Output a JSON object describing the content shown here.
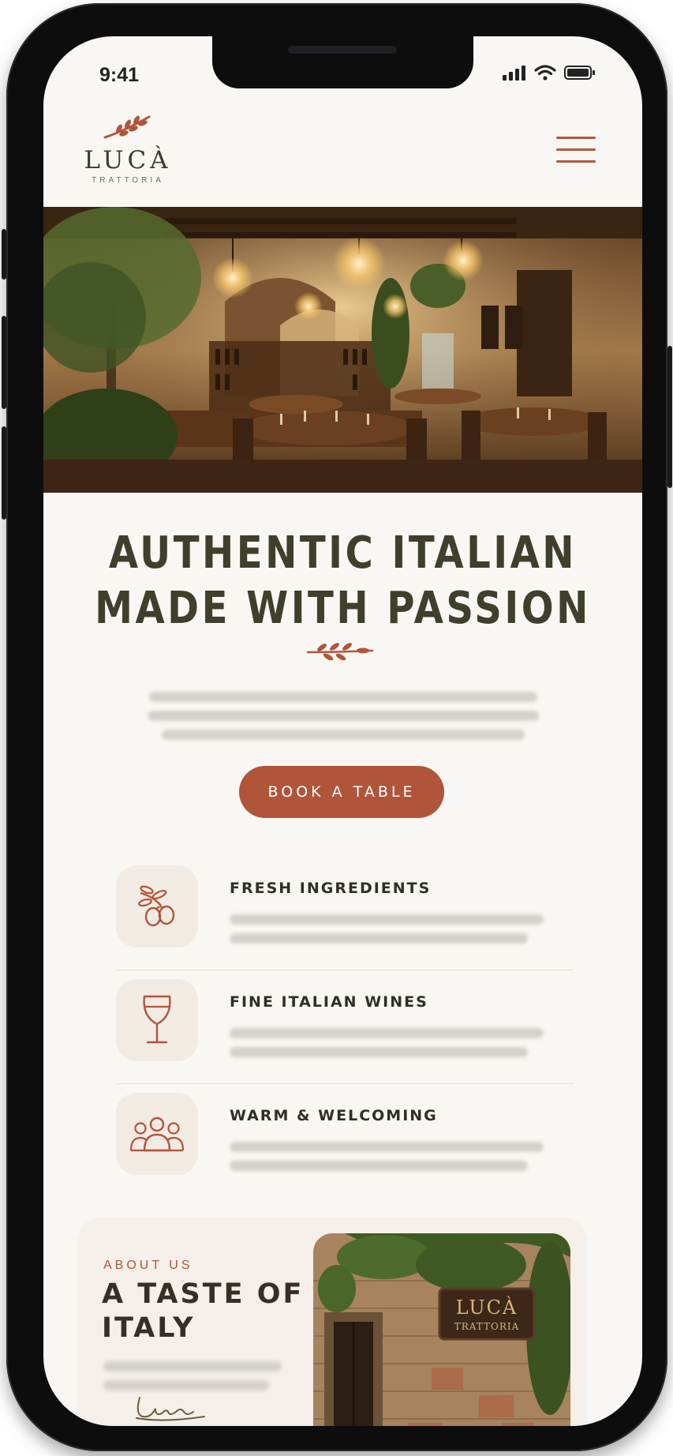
{
  "status_bar": {
    "time": "9:41"
  },
  "brand": {
    "name": "LUCÀ",
    "subtitle": "TRATTORIA"
  },
  "hero": {
    "headline_line1": "AUTHENTIC ITALIAN",
    "headline_line2": "MADE WITH PASSION",
    "cta_label": "BOOK A TABLE"
  },
  "features": [
    {
      "title": "FRESH INGREDIENTS",
      "icon": "olive-branch-icon"
    },
    {
      "title": "FINE ITALIAN WINES",
      "icon": "wine-glass-icon"
    },
    {
      "title": "WARM & WELCOMING",
      "icon": "people-group-icon"
    }
  ],
  "about": {
    "kicker": "ABOUT US",
    "title_line1": "A TASTE OF",
    "title_line2": "ITALY",
    "sign_name": "LUCÀ",
    "sign_subtitle": "TRATTORIA"
  },
  "colors": {
    "accent": "#b0553a",
    "text_dark": "#3f3f2c",
    "background": "#f9f7f4",
    "icon_tile": "#f2ebe3"
  }
}
